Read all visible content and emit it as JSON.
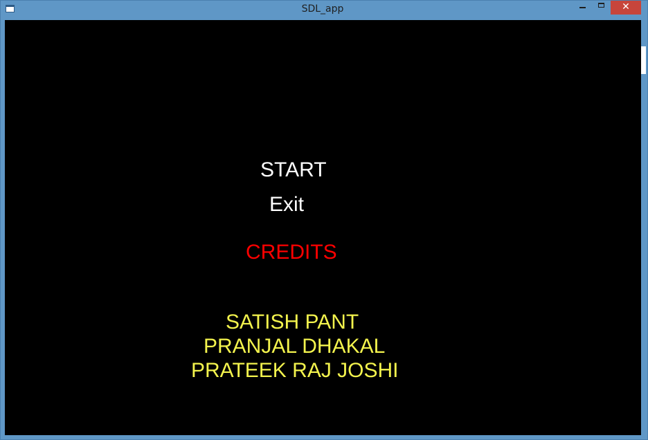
{
  "window": {
    "title": "SDL_app",
    "controls": {
      "minimize_icon": "minimize-icon",
      "maximize_icon": "maximize-icon",
      "close_label": "✕"
    },
    "colors": {
      "titlebar": "#5f97c6",
      "close": "#c7453b",
      "client_background": "#000000"
    }
  },
  "menu": {
    "start_label": "START",
    "exit_label": "Exit",
    "color": "#ffffff"
  },
  "credits": {
    "title": "CREDITS",
    "title_color": "#ff0000",
    "names": [
      "SATISH PANT",
      "PRANJAL DHAKAL",
      "PRATEEK RAJ JOSHI"
    ],
    "names_color": "#f3f34d"
  }
}
